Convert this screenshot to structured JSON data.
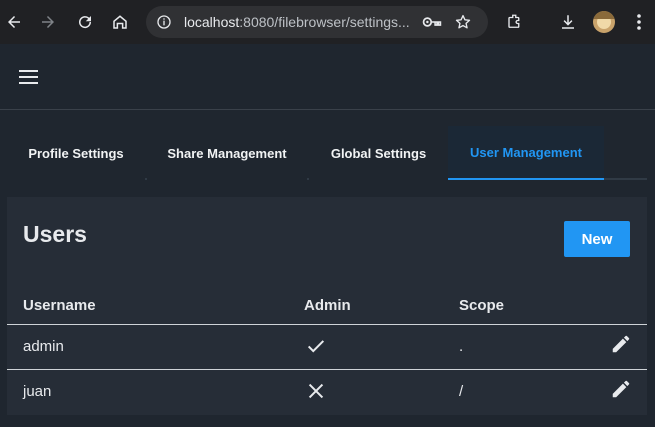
{
  "browser": {
    "url_host": "localhost",
    "url_rest": ":8080/filebrowser/settings..."
  },
  "tabs": [
    {
      "label": "Profile Settings",
      "active": false
    },
    {
      "label": "Share Management",
      "active": false
    },
    {
      "label": "Global Settings",
      "active": false
    },
    {
      "label": "User Management",
      "active": true
    }
  ],
  "users": {
    "title": "Users",
    "new_label": "New",
    "columns": [
      "Username",
      "Admin",
      "Scope"
    ],
    "rows": [
      {
        "username": "admin",
        "admin": true,
        "admin_icon": "check-icon",
        "scope": "."
      },
      {
        "username": "juan",
        "admin": false,
        "admin_icon": "close-icon",
        "scope": "/"
      }
    ]
  },
  "colors": {
    "accent": "#2196f3",
    "background": "#1f262f",
    "card": "#262d37"
  }
}
